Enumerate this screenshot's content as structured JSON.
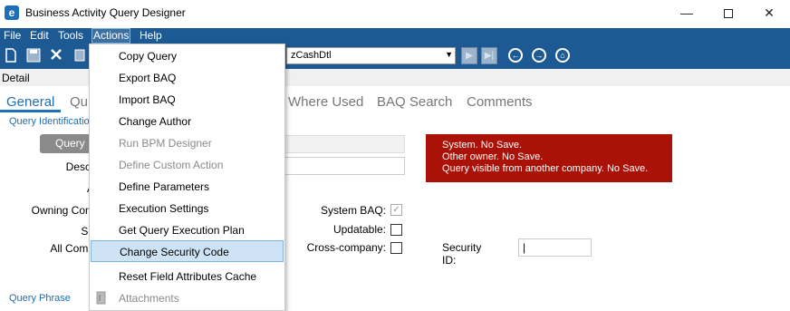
{
  "window": {
    "title": "Business Activity Query Designer",
    "app_icon": "e",
    "minimize_glyph": "—",
    "close_glyph": "✕"
  },
  "menubar": {
    "items": [
      "File",
      "Edit",
      "Tools",
      "Actions",
      "Help"
    ]
  },
  "toolbar": {
    "query_combo_value": "zCashDtl",
    "icons": [
      "new-icon",
      "save-icon",
      "delete-icon",
      "attach-icon",
      "next-icon",
      "last-icon",
      "back-icon",
      "forward-icon",
      "home-icon"
    ]
  },
  "detail": {
    "label": "Detail"
  },
  "tabs": {
    "items": [
      "General",
      "Qu",
      "Where Used",
      "BAQ Search",
      "Comments"
    ],
    "active": "General"
  },
  "form": {
    "group_query_identification": "Query Identification",
    "query_id_button": "Query I",
    "desc_label": "Descr",
    "a_label": "A",
    "owning_label": "Owning Com",
    "sh_label": "Sh",
    "all_comp_label": "All Comp",
    "system_baq_label": "System BAQ:",
    "updatable_label": "Updatable:",
    "cross_company_label": "Cross-company:",
    "security_id_label": "Security ID:",
    "security_id_value": "|",
    "group_query_phrase": "Query Phrase",
    "system_baq_checked": true,
    "updatable_checked": false,
    "cross_company_checked": false
  },
  "warning": {
    "lines": [
      "System. No Save.",
      "Other owner. No Save.",
      "Query visible from another company. No Save."
    ],
    "color": "#aa1208"
  },
  "actions_menu": {
    "items": [
      {
        "label": "Copy Query",
        "enabled": true
      },
      {
        "label": "Export BAQ",
        "enabled": true
      },
      {
        "label": "Import BAQ",
        "enabled": true
      },
      {
        "label": "Change Author",
        "enabled": true
      },
      {
        "label": "Run BPM Designer",
        "enabled": false
      },
      {
        "label": "Define Custom Action",
        "enabled": false
      },
      {
        "label": "Define Parameters",
        "enabled": true
      },
      {
        "label": "Execution Settings",
        "enabled": true
      },
      {
        "label": "Get Query Execution Plan",
        "enabled": true
      },
      {
        "label": "Change Security Code",
        "enabled": true,
        "highlighted": true
      },
      {
        "label": "Reset Field Attributes Cache",
        "enabled": true
      },
      {
        "label": "Attachments",
        "enabled": false,
        "icon": "paperclip-icon"
      }
    ]
  },
  "colors": {
    "menubar": "#1d5a93",
    "accent": "#1f6fb3"
  }
}
